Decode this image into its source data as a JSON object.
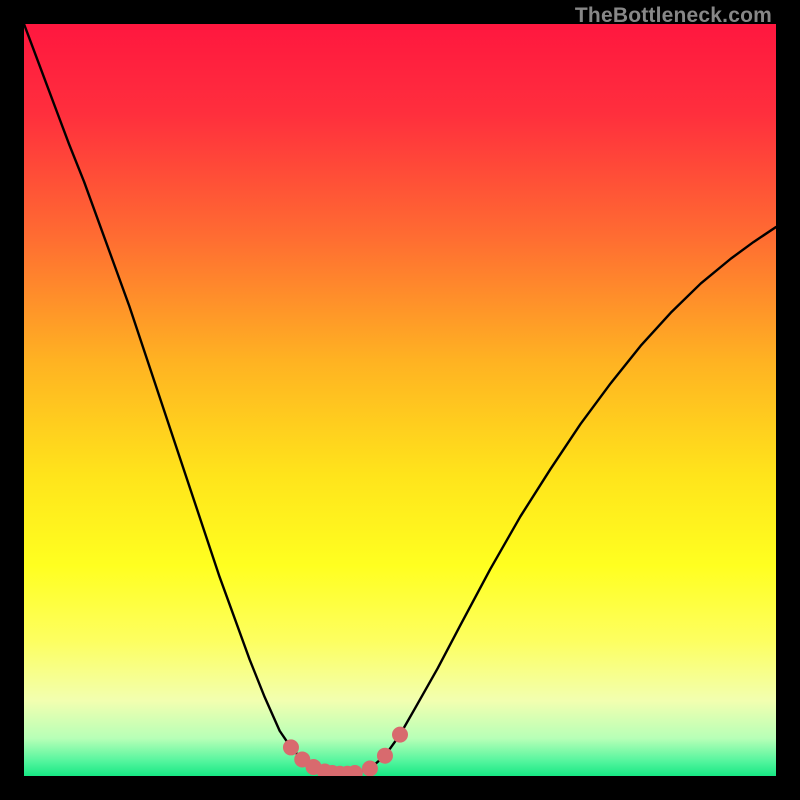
{
  "watermark": "TheBottleneck.com",
  "gradient_stops": [
    {
      "offset": 0,
      "color": "#ff173f"
    },
    {
      "offset": 0.12,
      "color": "#ff2f3d"
    },
    {
      "offset": 0.28,
      "color": "#ff6b32"
    },
    {
      "offset": 0.45,
      "color": "#ffb322"
    },
    {
      "offset": 0.6,
      "color": "#ffe41b"
    },
    {
      "offset": 0.72,
      "color": "#ffff20"
    },
    {
      "offset": 0.82,
      "color": "#fdff60"
    },
    {
      "offset": 0.9,
      "color": "#f2ffb0"
    },
    {
      "offset": 0.95,
      "color": "#b7ffb7"
    },
    {
      "offset": 0.98,
      "color": "#55f59e"
    },
    {
      "offset": 1.0,
      "color": "#17e884"
    }
  ],
  "curve_color": "#000000",
  "marker_color": "#d86a6e",
  "marker_radius": 8,
  "chart_data": {
    "type": "line",
    "title": "",
    "xlabel": "",
    "ylabel": "",
    "xlim": [
      0,
      1
    ],
    "ylim": [
      0,
      1
    ],
    "series": [
      {
        "name": "bottleneck-curve",
        "x": [
          0.0,
          0.015,
          0.03,
          0.045,
          0.06,
          0.08,
          0.1,
          0.12,
          0.14,
          0.16,
          0.18,
          0.2,
          0.22,
          0.24,
          0.26,
          0.28,
          0.3,
          0.32,
          0.34,
          0.355,
          0.37,
          0.385,
          0.4,
          0.41,
          0.42,
          0.43,
          0.44,
          0.46,
          0.48,
          0.5,
          0.52,
          0.55,
          0.58,
          0.62,
          0.66,
          0.7,
          0.74,
          0.78,
          0.82,
          0.86,
          0.9,
          0.94,
          0.97,
          1.0
        ],
        "y": [
          1.0,
          0.96,
          0.92,
          0.88,
          0.84,
          0.79,
          0.735,
          0.68,
          0.625,
          0.565,
          0.505,
          0.445,
          0.385,
          0.325,
          0.265,
          0.21,
          0.155,
          0.105,
          0.06,
          0.038,
          0.022,
          0.012,
          0.006,
          0.004,
          0.003,
          0.003,
          0.004,
          0.01,
          0.027,
          0.055,
          0.09,
          0.143,
          0.2,
          0.275,
          0.345,
          0.408,
          0.468,
          0.522,
          0.572,
          0.616,
          0.655,
          0.688,
          0.71,
          0.73
        ]
      }
    ],
    "markers": {
      "name": "highlight-points",
      "x": [
        0.355,
        0.37,
        0.385,
        0.4,
        0.41,
        0.42,
        0.43,
        0.44,
        0.46,
        0.48,
        0.5
      ],
      "y": [
        0.038,
        0.022,
        0.012,
        0.006,
        0.004,
        0.003,
        0.003,
        0.004,
        0.01,
        0.027,
        0.055
      ]
    }
  }
}
